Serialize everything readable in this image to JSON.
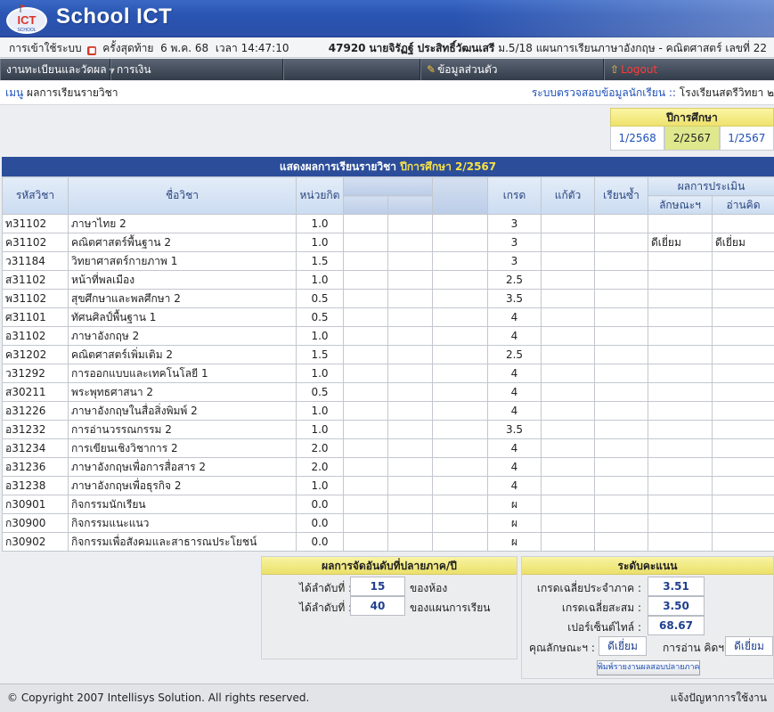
{
  "header": {
    "app_title": "School ICT",
    "logo_text": "ICT",
    "logo_sub": "SCHOOL"
  },
  "infobar": {
    "login_label": "การเข้าใช้ระบบ",
    "last_label": "ครั้งสุดท้าย",
    "last_date": "6 พ.ค. 68",
    "time_label": "เวลา",
    "last_time": "14:47:10",
    "student_id": "47920",
    "student_name": "นายจิรัฏฐ์ ประสิทธิ์วัฒนเสรี",
    "class_info": "ม.5/18 แผนการเรียนภาษาอังกฤษ - คณิตศาสตร์ เลขที่ 22"
  },
  "menu": {
    "items": [
      {
        "label": "งานทะเบียนและวัดผล"
      },
      {
        "label": "การเงิน"
      },
      {
        "label": "ข้อมูลส่วนตัว"
      },
      {
        "label": "Logout"
      }
    ]
  },
  "pagebar": {
    "menu_label": "เมนู",
    "page_title": "ผลการเรียนรายวิชา",
    "system_label": "ระบบตรวจสอบข้อมูลนักเรียน ::",
    "school_name": "โรงเรียนสตรีวิทยา ๒"
  },
  "years": {
    "title": "ปีการศึกษา",
    "options": [
      "1/2568",
      "2/2567",
      "1/2567"
    ],
    "selected": "2/2567"
  },
  "results": {
    "title": "แสดงผลการเรียนรายวิชา",
    "year_label": "ปีการศึกษา 2/2567",
    "headers": {
      "code": "รหัสวิชา",
      "name": "ชื่อวิชา",
      "credit": "หน่วยกิต",
      "grade": "เกรด",
      "fix": "แก้ตัว",
      "retake": "เรียนซ้ำ",
      "eval": "ผลการประเมิน",
      "trait": "ลักษณะฯ",
      "read": "อ่านคิด"
    },
    "rows": [
      {
        "code": "ท31102",
        "name": "ภาษาไทย 2",
        "credit": "1.0",
        "grade": "3",
        "trait": "",
        "read": ""
      },
      {
        "code": "ค31102",
        "name": "คณิตศาสตร์พื้นฐาน 2",
        "credit": "1.0",
        "grade": "3",
        "trait": "ดีเยี่ยม",
        "read": "ดีเยี่ยม"
      },
      {
        "code": "ว31184",
        "name": "วิทยาศาสตร์กายภาพ 1",
        "credit": "1.5",
        "grade": "3",
        "trait": "",
        "read": ""
      },
      {
        "code": "ส31102",
        "name": "หน้าที่พลเมือง",
        "credit": "1.0",
        "grade": "2.5",
        "trait": "",
        "read": ""
      },
      {
        "code": "พ31102",
        "name": "สุขศึกษาและพลศึกษา 2",
        "credit": "0.5",
        "grade": "3.5",
        "trait": "",
        "read": ""
      },
      {
        "code": "ศ31101",
        "name": "ทัศนศิลป์พื้นฐาน 1",
        "credit": "0.5",
        "grade": "4",
        "trait": "",
        "read": ""
      },
      {
        "code": "อ31102",
        "name": "ภาษาอังกฤษ 2",
        "credit": "1.0",
        "grade": "4",
        "trait": "",
        "read": ""
      },
      {
        "code": "ค31202",
        "name": "คณิตศาสตร์เพิ่มเติม 2",
        "credit": "1.5",
        "grade": "2.5",
        "trait": "",
        "read": ""
      },
      {
        "code": "ว31292",
        "name": "การออกแบบและเทคโนโลยี 1",
        "credit": "1.0",
        "grade": "4",
        "trait": "",
        "read": ""
      },
      {
        "code": "ส30211",
        "name": "พระพุทธศาสนา 2",
        "credit": "0.5",
        "grade": "4",
        "trait": "",
        "read": ""
      },
      {
        "code": "อ31226",
        "name": "ภาษาอังกฤษในสื่อสิ่งพิมพ์ 2",
        "credit": "1.0",
        "grade": "4",
        "trait": "",
        "read": ""
      },
      {
        "code": "อ31232",
        "name": "การอ่านวรรณกรรม 2",
        "credit": "1.0",
        "grade": "3.5",
        "trait": "",
        "read": ""
      },
      {
        "code": "อ31234",
        "name": "การเขียนเชิงวิชาการ 2",
        "credit": "2.0",
        "grade": "4",
        "trait": "",
        "read": ""
      },
      {
        "code": "อ31236",
        "name": "ภาษาอังกฤษเพื่อการสื่อสาร 2",
        "credit": "2.0",
        "grade": "4",
        "trait": "",
        "read": ""
      },
      {
        "code": "อ31238",
        "name": "ภาษาอังกฤษเพื่อธุรกิจ 2",
        "credit": "1.0",
        "grade": "4",
        "trait": "",
        "read": ""
      },
      {
        "code": "ก30901",
        "name": "กิจกรรมนักเรียน",
        "credit": "0.0",
        "grade": "ผ",
        "trait": "",
        "read": ""
      },
      {
        "code": "ก30900",
        "name": "กิจกรรมแนะแนว",
        "credit": "0.0",
        "grade": "ผ",
        "trait": "",
        "read": ""
      },
      {
        "code": "ก30902",
        "name": "กิจกรรมเพื่อสังคมและสาธารณประโยชน์",
        "credit": "0.0",
        "grade": "ผ",
        "trait": "",
        "read": ""
      }
    ]
  },
  "rank": {
    "title": "ผลการจัดอันดับที่ปลายภาค/ปี",
    "room_label": "ได้ลำดับที่ :",
    "room_value": "15",
    "room_suffix": "ของห้อง",
    "plan_label": "ได้ลำดับที่ :",
    "plan_value": "40",
    "plan_suffix": "ของแผนการเรียน"
  },
  "score": {
    "title": "ระดับคะแนน",
    "gpa_term_label": "เกรดเฉลี่ยประจำภาค :",
    "gpa_term": "3.51",
    "gpax_label": "เกรดเฉลี่ยสะสม :",
    "gpax": "3.50",
    "percentile_label": "เปอร์เซ็นต์ไทล์ :",
    "percentile": "68.67",
    "trait_label": "คุณลักษณะฯ :",
    "trait_value": "ดีเยี่ยม",
    "read_label": "การอ่าน คิดฯ :",
    "read_value": "ดีเยี่ยม",
    "print_label": "พิมพ์รายงานผลสอบปลายภาค"
  },
  "footer": {
    "copyright": "© Copyright 2007 Intellisys Solution. All rights reserved.",
    "help": "แจ้งปัญหาการใช้งาน"
  }
}
